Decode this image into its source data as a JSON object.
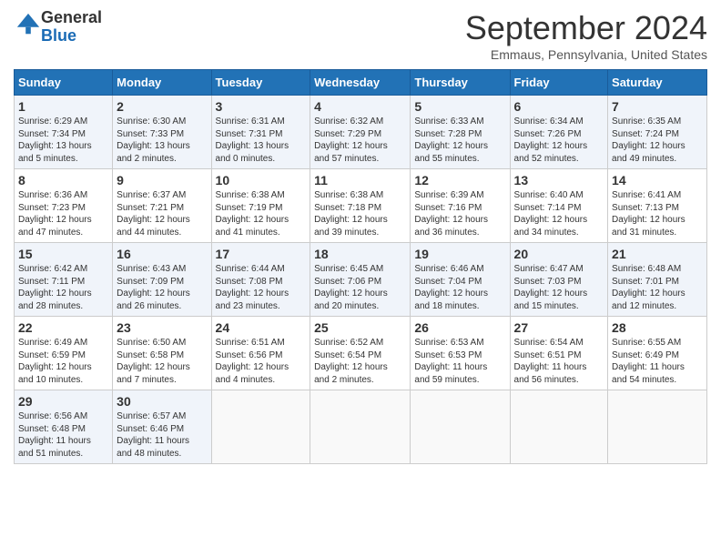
{
  "header": {
    "logo_general": "General",
    "logo_blue": "Blue",
    "month_title": "September 2024",
    "location": "Emmaus, Pennsylvania, United States"
  },
  "calendar": {
    "days_of_week": [
      "Sunday",
      "Monday",
      "Tuesday",
      "Wednesday",
      "Thursday",
      "Friday",
      "Saturday"
    ],
    "weeks": [
      [
        {
          "day": 1,
          "info": "Sunrise: 6:29 AM\nSunset: 7:34 PM\nDaylight: 13 hours\nand 5 minutes."
        },
        {
          "day": 2,
          "info": "Sunrise: 6:30 AM\nSunset: 7:33 PM\nDaylight: 13 hours\nand 2 minutes."
        },
        {
          "day": 3,
          "info": "Sunrise: 6:31 AM\nSunset: 7:31 PM\nDaylight: 13 hours\nand 0 minutes."
        },
        {
          "day": 4,
          "info": "Sunrise: 6:32 AM\nSunset: 7:29 PM\nDaylight: 12 hours\nand 57 minutes."
        },
        {
          "day": 5,
          "info": "Sunrise: 6:33 AM\nSunset: 7:28 PM\nDaylight: 12 hours\nand 55 minutes."
        },
        {
          "day": 6,
          "info": "Sunrise: 6:34 AM\nSunset: 7:26 PM\nDaylight: 12 hours\nand 52 minutes."
        },
        {
          "day": 7,
          "info": "Sunrise: 6:35 AM\nSunset: 7:24 PM\nDaylight: 12 hours\nand 49 minutes."
        }
      ],
      [
        {
          "day": 8,
          "info": "Sunrise: 6:36 AM\nSunset: 7:23 PM\nDaylight: 12 hours\nand 47 minutes."
        },
        {
          "day": 9,
          "info": "Sunrise: 6:37 AM\nSunset: 7:21 PM\nDaylight: 12 hours\nand 44 minutes."
        },
        {
          "day": 10,
          "info": "Sunrise: 6:38 AM\nSunset: 7:19 PM\nDaylight: 12 hours\nand 41 minutes."
        },
        {
          "day": 11,
          "info": "Sunrise: 6:38 AM\nSunset: 7:18 PM\nDaylight: 12 hours\nand 39 minutes."
        },
        {
          "day": 12,
          "info": "Sunrise: 6:39 AM\nSunset: 7:16 PM\nDaylight: 12 hours\nand 36 minutes."
        },
        {
          "day": 13,
          "info": "Sunrise: 6:40 AM\nSunset: 7:14 PM\nDaylight: 12 hours\nand 34 minutes."
        },
        {
          "day": 14,
          "info": "Sunrise: 6:41 AM\nSunset: 7:13 PM\nDaylight: 12 hours\nand 31 minutes."
        }
      ],
      [
        {
          "day": 15,
          "info": "Sunrise: 6:42 AM\nSunset: 7:11 PM\nDaylight: 12 hours\nand 28 minutes."
        },
        {
          "day": 16,
          "info": "Sunrise: 6:43 AM\nSunset: 7:09 PM\nDaylight: 12 hours\nand 26 minutes."
        },
        {
          "day": 17,
          "info": "Sunrise: 6:44 AM\nSunset: 7:08 PM\nDaylight: 12 hours\nand 23 minutes."
        },
        {
          "day": 18,
          "info": "Sunrise: 6:45 AM\nSunset: 7:06 PM\nDaylight: 12 hours\nand 20 minutes."
        },
        {
          "day": 19,
          "info": "Sunrise: 6:46 AM\nSunset: 7:04 PM\nDaylight: 12 hours\nand 18 minutes."
        },
        {
          "day": 20,
          "info": "Sunrise: 6:47 AM\nSunset: 7:03 PM\nDaylight: 12 hours\nand 15 minutes."
        },
        {
          "day": 21,
          "info": "Sunrise: 6:48 AM\nSunset: 7:01 PM\nDaylight: 12 hours\nand 12 minutes."
        }
      ],
      [
        {
          "day": 22,
          "info": "Sunrise: 6:49 AM\nSunset: 6:59 PM\nDaylight: 12 hours\nand 10 minutes."
        },
        {
          "day": 23,
          "info": "Sunrise: 6:50 AM\nSunset: 6:58 PM\nDaylight: 12 hours\nand 7 minutes."
        },
        {
          "day": 24,
          "info": "Sunrise: 6:51 AM\nSunset: 6:56 PM\nDaylight: 12 hours\nand 4 minutes."
        },
        {
          "day": 25,
          "info": "Sunrise: 6:52 AM\nSunset: 6:54 PM\nDaylight: 12 hours\nand 2 minutes."
        },
        {
          "day": 26,
          "info": "Sunrise: 6:53 AM\nSunset: 6:53 PM\nDaylight: 11 hours\nand 59 minutes."
        },
        {
          "day": 27,
          "info": "Sunrise: 6:54 AM\nSunset: 6:51 PM\nDaylight: 11 hours\nand 56 minutes."
        },
        {
          "day": 28,
          "info": "Sunrise: 6:55 AM\nSunset: 6:49 PM\nDaylight: 11 hours\nand 54 minutes."
        }
      ],
      [
        {
          "day": 29,
          "info": "Sunrise: 6:56 AM\nSunset: 6:48 PM\nDaylight: 11 hours\nand 51 minutes."
        },
        {
          "day": 30,
          "info": "Sunrise: 6:57 AM\nSunset: 6:46 PM\nDaylight: 11 hours\nand 48 minutes."
        },
        null,
        null,
        null,
        null,
        null
      ]
    ]
  }
}
